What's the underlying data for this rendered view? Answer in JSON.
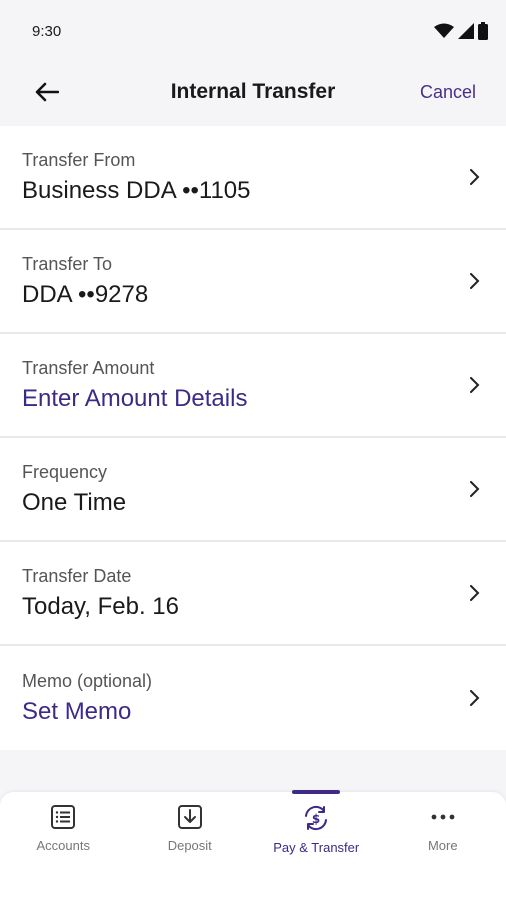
{
  "status": {
    "time": "9:30"
  },
  "header": {
    "title": "Internal Transfer",
    "cancel_label": "Cancel"
  },
  "rows": [
    {
      "label": "Transfer From",
      "value": "Business DDA ••1105"
    },
    {
      "label": "Transfer To",
      "value": "DDA ••9278"
    },
    {
      "label": "Transfer Amount",
      "value": "Enter Amount Details"
    },
    {
      "label": "Frequency",
      "value": "One Time"
    },
    {
      "label": "Transfer Date",
      "value": "Today, Feb. 16"
    },
    {
      "label": "Memo (optional)",
      "value": "Set Memo"
    }
  ],
  "tabs": [
    {
      "label": "Accounts",
      "icon": "list-icon"
    },
    {
      "label": "Deposit",
      "icon": "deposit-icon"
    },
    {
      "label": "Pay & Transfer",
      "icon": "pay-transfer-icon",
      "active": true
    },
    {
      "label": "More",
      "icon": "more-icon"
    }
  ],
  "colors": {
    "accent": "#3d2a86",
    "background": "#f5f5f7"
  }
}
